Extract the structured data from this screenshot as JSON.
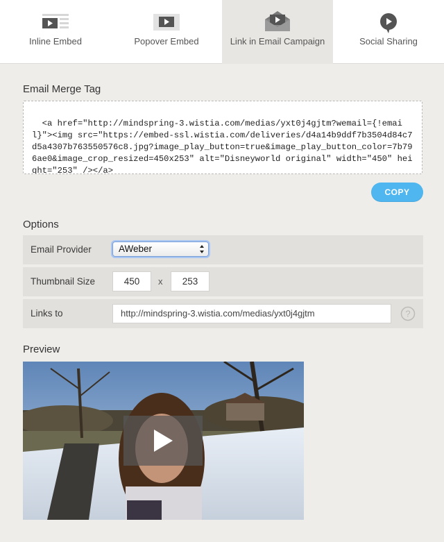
{
  "tabs": [
    {
      "label": "Inline Embed",
      "icon": "inline-embed-icon",
      "active": false
    },
    {
      "label": "Popover Embed",
      "icon": "popover-embed-icon",
      "active": false
    },
    {
      "label": "Link in Email Campaign",
      "icon": "email-campaign-icon",
      "active": true
    },
    {
      "label": "Social Sharing",
      "icon": "social-sharing-icon",
      "active": false
    }
  ],
  "merge_tag": {
    "title": "Email Merge Tag",
    "code": "<a href=\"http://mindspring-3.wistia.com/medias/yxt0j4gjtm?wemail={!email}\"><img src=\"https://embed-ssl.wistia.com/deliveries/d4a14b9ddf7b3504d84c7d5a4307b763550576c8.jpg?image_play_button=true&image_play_button_color=7b796ae0&image_crop_resized=450x253\" alt=\"Disneyworld original\" width=\"450\" height=\"253\" /></a>",
    "copy_label": "COPY"
  },
  "options": {
    "title": "Options",
    "provider_label": "Email Provider",
    "provider_value": "AWeber",
    "thumb_label": "Thumbnail Size",
    "thumb_width": "450",
    "thumb_sep": "x",
    "thumb_height": "253",
    "links_label": "Links to",
    "links_value": "http://mindspring-3.wistia.com/medias/yxt0j4gjtm"
  },
  "preview": {
    "title": "Preview"
  },
  "colors": {
    "accent": "#4fb6ef",
    "active_tab": "#e8e6e2",
    "background": "#efedea"
  }
}
